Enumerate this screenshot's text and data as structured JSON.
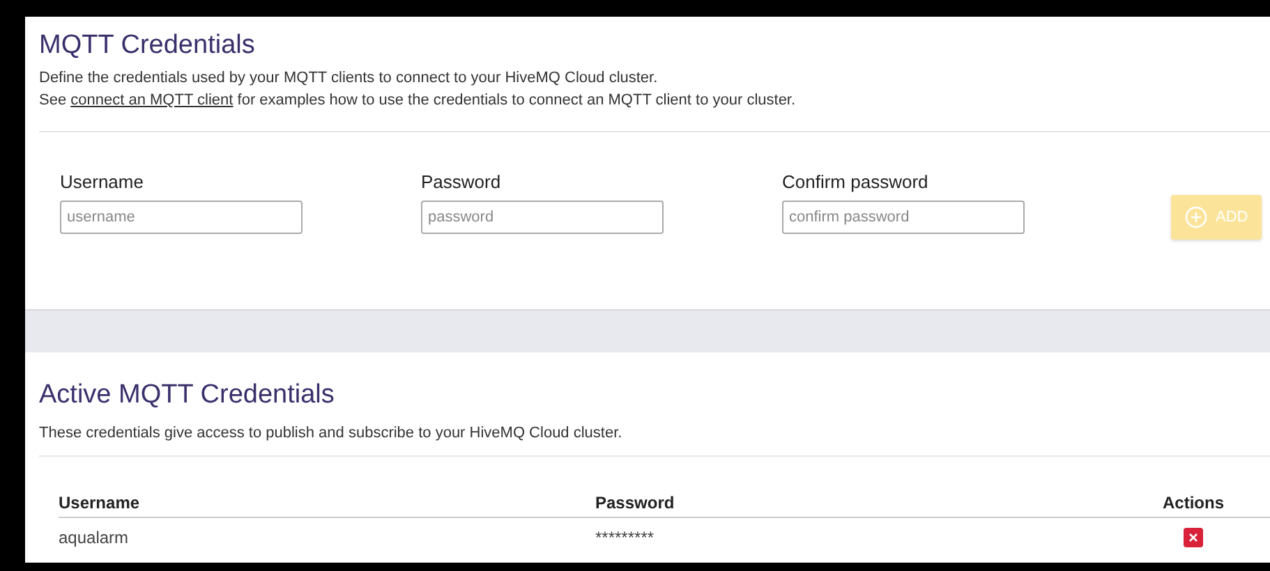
{
  "credentials_form": {
    "title": "MQTT Credentials",
    "description": "Define the credentials used by your MQTT clients to connect to your HiveMQ Cloud cluster.",
    "see_prefix": "See ",
    "link": "connect an MQTT client",
    "see_suffix": " for examples how to use the credentials to connect an MQTT client to your cluster.",
    "fields": [
      {
        "label": "Username",
        "placeholder": "username"
      },
      {
        "label": "Password",
        "placeholder": "password"
      },
      {
        "label": "Confirm password",
        "placeholder": "confirm password"
      }
    ],
    "add_button": {
      "label": "ADD",
      "disabled": true
    }
  },
  "active_credentials": {
    "title": "Active MQTT Credentials",
    "description": "These credentials give access to publish and subscribe to your HiveMQ Cloud cluster.",
    "columns": [
      "Username",
      "Password",
      "Actions"
    ],
    "rows": [
      {
        "username": "aqualarm",
        "password": "*********"
      }
    ]
  }
}
